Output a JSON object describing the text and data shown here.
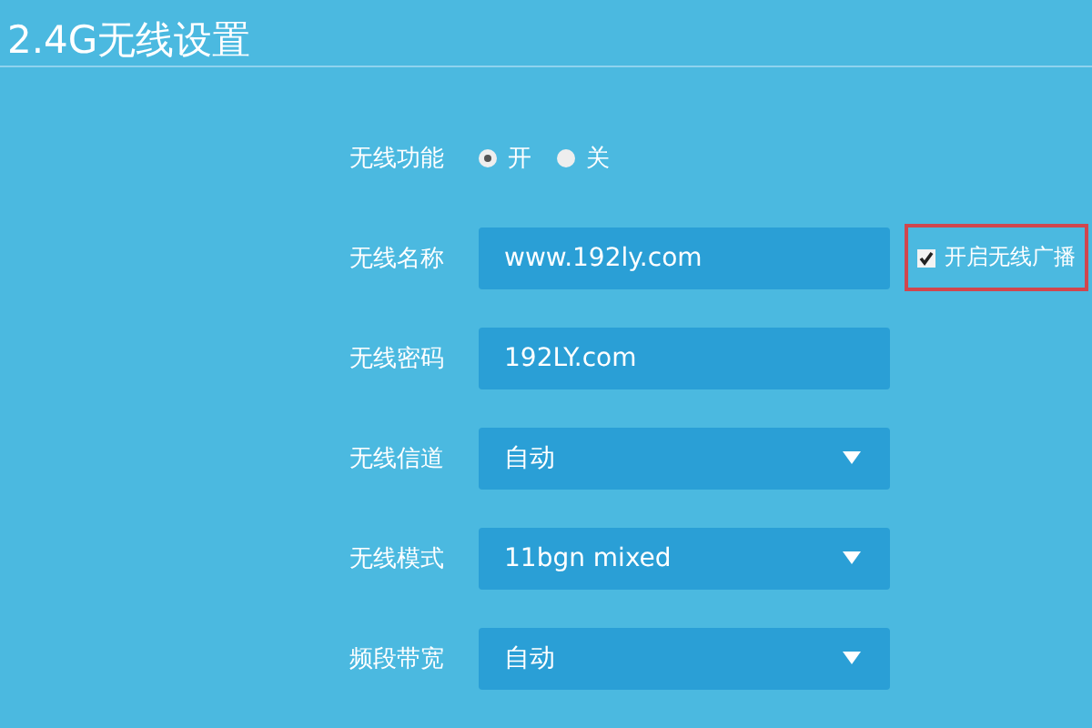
{
  "title": "2.4G无线设置",
  "rows": [
    {
      "kind": "radio",
      "label": "无线功能",
      "options": [
        {
          "label": "开",
          "selected": true
        },
        {
          "label": "关",
          "selected": false
        }
      ]
    },
    {
      "kind": "text",
      "label": "无线名称",
      "value": "www.192ly.com",
      "checkbox": {
        "label": "开启无线广播",
        "checked": true,
        "highlighted": true
      }
    },
    {
      "kind": "text",
      "label": "无线密码",
      "value": "192LY.com"
    },
    {
      "kind": "select",
      "label": "无线信道",
      "value": "自动"
    },
    {
      "kind": "select",
      "label": "无线模式",
      "value": "11bgn mixed"
    },
    {
      "kind": "select",
      "label": "频段带宽",
      "value": "自动"
    }
  ]
}
